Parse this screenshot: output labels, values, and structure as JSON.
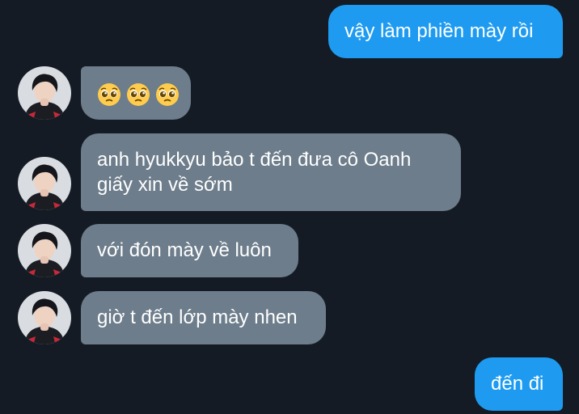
{
  "conversation": {
    "messages": [
      {
        "side": "outgoing",
        "text": "vậy làm phiền mày rồi"
      },
      {
        "side": "incoming",
        "emojis": [
          "pleading-face",
          "pleading-face",
          "pleading-face"
        ]
      },
      {
        "side": "incoming",
        "lines": [
          "anh hyukkyu bảo t đến đưa cô Oanh",
          "giấy xin về sớm"
        ]
      },
      {
        "side": "incoming",
        "text": "với đón mày về luôn"
      },
      {
        "side": "incoming",
        "text": "giờ t đến lớp mày nhen"
      },
      {
        "side": "outgoing",
        "text": "đến đi"
      }
    ]
  },
  "colors": {
    "background": "#151b24",
    "outgoing_bubble": "#1e9bf0",
    "incoming_bubble": "#6d7d8b",
    "text": "#ffffff"
  },
  "icons": {
    "avatar": "contact-avatar-photo",
    "emoji": "pleading-face-emoji"
  }
}
